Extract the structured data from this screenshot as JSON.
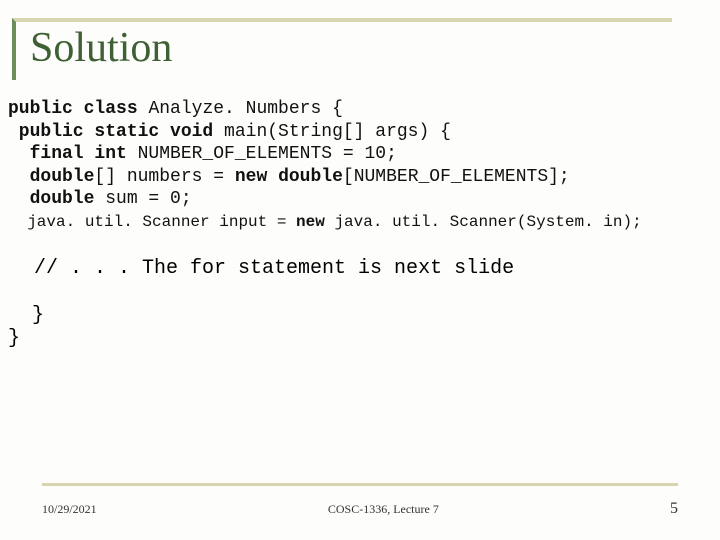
{
  "title": "Solution",
  "code": {
    "l1a": "public class ",
    "l1b": "Analyze. Numbers {",
    "l2a": " public static void ",
    "l2b": "main(String[] args) {",
    "l3a": "  final int ",
    "l3b": "NUMBER_OF_ELEMENTS = 10;",
    "l4a": "  double",
    "l4b": "[] numbers = ",
    "l4c": "new double",
    "l4d": "[NUMBER_OF_ELEMENTS];",
    "l5a": "  double ",
    "l5b": "sum = 0;",
    "l6a": "  java. util. Scanner input = ",
    "l6b": "new ",
    "l6c": "java. util. Scanner(System. in);"
  },
  "comment": "// . . . The for statement is next slide",
  "closers": "  }\n}",
  "footer": {
    "date": "10/29/2021",
    "center": "COSC-1336, Lecture 7",
    "page": "5"
  }
}
